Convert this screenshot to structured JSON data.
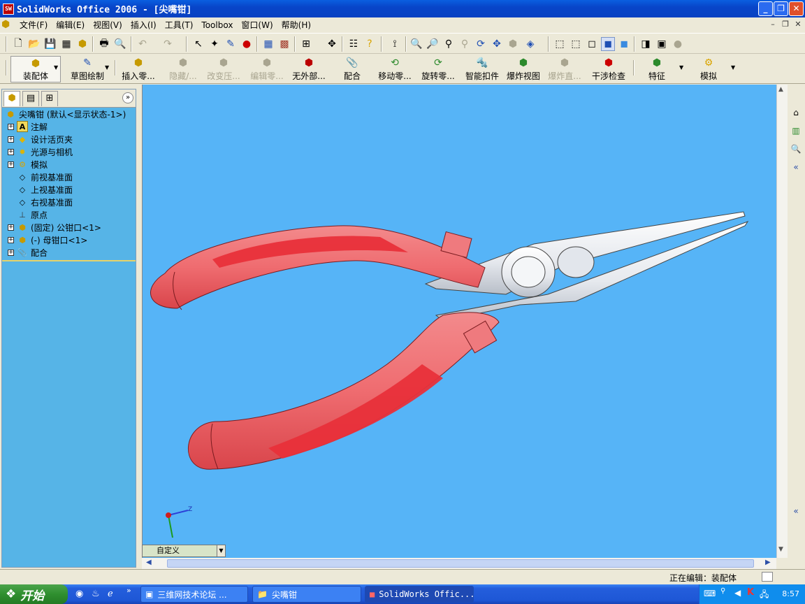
{
  "window": {
    "title": "SolidWorks Office 2006 - [尖嘴钳]",
    "app_icon": "SW"
  },
  "menu": {
    "items": [
      "文件(F)",
      "编辑(E)",
      "视图(V)",
      "插入(I)",
      "工具(T)",
      "Toolbox",
      "窗口(W)",
      "帮助(H)"
    ]
  },
  "command_manager": {
    "tabs": [
      {
        "label": "装配体",
        "icon": "assembly-icon"
      },
      {
        "label": "草图绘制",
        "icon": "sketch-icon"
      }
    ],
    "buttons": [
      {
        "label": "插入零...",
        "icon": "insert-component-icon",
        "enabled": true
      },
      {
        "label": "隐藏/...",
        "icon": "hide-show-icon",
        "enabled": false
      },
      {
        "label": "改变压...",
        "icon": "change-suppression-icon",
        "enabled": false
      },
      {
        "label": "编辑零...",
        "icon": "edit-component-icon",
        "enabled": false
      },
      {
        "label": "无外部...",
        "icon": "no-external-refs-icon",
        "enabled": true
      },
      {
        "label": "配合",
        "icon": "mate-icon",
        "enabled": true
      },
      {
        "label": "移动零...",
        "icon": "move-component-icon",
        "enabled": true
      },
      {
        "label": "旋转零...",
        "icon": "rotate-component-icon",
        "enabled": true
      },
      {
        "label": "智能扣件",
        "icon": "smart-fasteners-icon",
        "enabled": true
      },
      {
        "label": "爆炸视图",
        "icon": "exploded-view-icon",
        "enabled": true
      },
      {
        "label": "爆炸直...",
        "icon": "explode-line-icon",
        "enabled": false
      },
      {
        "label": "干涉检查",
        "icon": "interference-check-icon",
        "enabled": true
      },
      {
        "label": "特征",
        "icon": "features-icon",
        "enabled": true
      },
      {
        "label": "模拟",
        "icon": "simulation-icon",
        "enabled": true
      }
    ]
  },
  "feature_tree": {
    "root": "尖嘴钳  (默认<显示状态-1>)",
    "items": [
      {
        "label": "注解",
        "icon": "annotations-icon",
        "expandable": true
      },
      {
        "label": "设计活页夹",
        "icon": "design-binder-icon",
        "expandable": true
      },
      {
        "label": "光源与相机",
        "icon": "lights-cameras-icon",
        "expandable": true
      },
      {
        "label": "模拟",
        "icon": "simulation-icon",
        "expandable": true
      },
      {
        "label": "前视基准面",
        "icon": "plane-icon",
        "expandable": false
      },
      {
        "label": "上视基准面",
        "icon": "plane-icon",
        "expandable": false
      },
      {
        "label": "右视基准面",
        "icon": "plane-icon",
        "expandable": false
      },
      {
        "label": "原点",
        "icon": "origin-icon",
        "expandable": false
      },
      {
        "label": "(固定) 公钳口<1>",
        "icon": "part-icon",
        "expandable": true
      },
      {
        "label": "(-) 母钳口<1>",
        "icon": "part-icon",
        "expandable": true
      },
      {
        "label": "配合",
        "icon": "mates-icon",
        "expandable": true
      }
    ]
  },
  "viewport": {
    "background": "#56b4f7",
    "triad_axis_label": "Z",
    "config_select": "自定义"
  },
  "status": {
    "text": "正在编辑：装配体"
  },
  "taskbar": {
    "start_label": "开始",
    "tasks": [
      {
        "label": "三维网技术论坛 ...",
        "active": false
      },
      {
        "label": "尖嘴钳",
        "active": false
      },
      {
        "label": "SolidWorks Offic...",
        "active": true
      }
    ],
    "clock": "8:57"
  },
  "colors": {
    "handle_red": "#e8303a",
    "handle_pink": "#f07a7e",
    "metal": "#e6e9ee",
    "titlebar": "#0845c9"
  }
}
